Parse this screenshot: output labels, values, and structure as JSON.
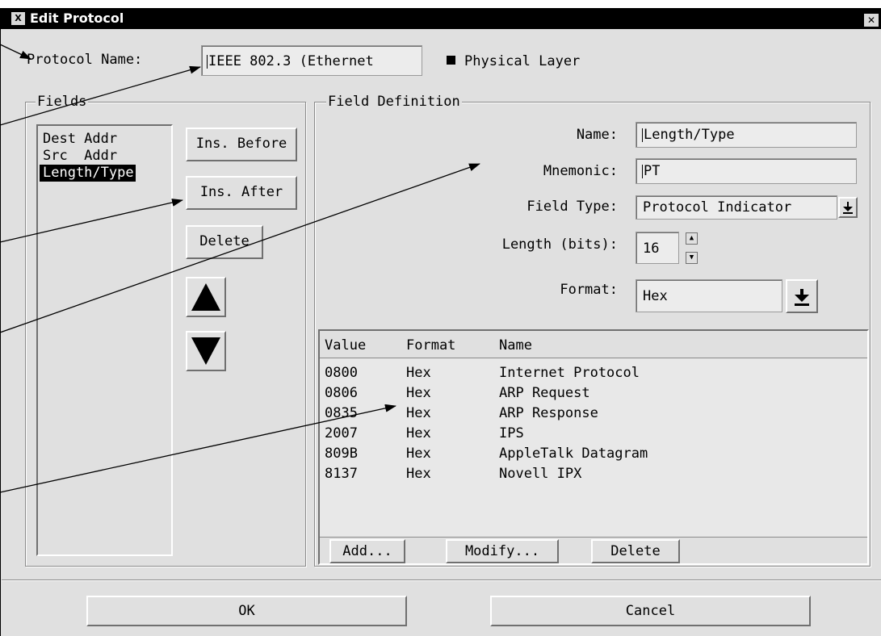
{
  "window": {
    "title": "Edit Protocol",
    "app_icon": "x-icon",
    "close_glyph": "✕"
  },
  "protocol": {
    "name_label": "Protocol Name:",
    "name_value": "IEEE 802.3 (Ethernet",
    "physical_layer_label": "Physical Layer",
    "physical_layer_checked": true
  },
  "fields": {
    "legend": "Fields",
    "items": [
      "Dest Addr",
      "Src  Addr",
      "Length/Type"
    ],
    "selected_index": 2,
    "ins_before": "Ins. Before",
    "ins_after": "Ins. After",
    "delete": "Delete"
  },
  "field_definition": {
    "legend": "Field Definition",
    "name_label": "Name:",
    "name_value": "Length/Type",
    "mnemonic_label": "Mnemonic:",
    "mnemonic_value": "PT",
    "type_label": "Field Type:",
    "type_value": "Protocol Indicator",
    "length_label": "Length (bits):",
    "length_value": "16",
    "format_label": "Format:",
    "format_value": "Hex"
  },
  "values_table": {
    "headers": {
      "value": "Value",
      "format": "Format",
      "name": "Name"
    },
    "rows": [
      {
        "value": "0800",
        "format": "Hex",
        "name": "Internet Protocol"
      },
      {
        "value": "0806",
        "format": "Hex",
        "name": "ARP Request"
      },
      {
        "value": "0835",
        "format": "Hex",
        "name": "ARP Response"
      },
      {
        "value": "2007",
        "format": "Hex",
        "name": "IPS"
      },
      {
        "value": "809B",
        "format": "Hex",
        "name": "AppleTalk Datagram"
      },
      {
        "value": "8137",
        "format": "Hex",
        "name": "Novell IPX"
      }
    ],
    "add": "Add...",
    "modify": "Modify...",
    "delete": "Delete"
  },
  "footer": {
    "ok": "OK",
    "cancel": "Cancel"
  },
  "colors": {
    "window_bg": "#e0e0e0",
    "titlebar_bg": "#000000",
    "field_bg": "#ececec",
    "selection_bg": "#000000"
  }
}
